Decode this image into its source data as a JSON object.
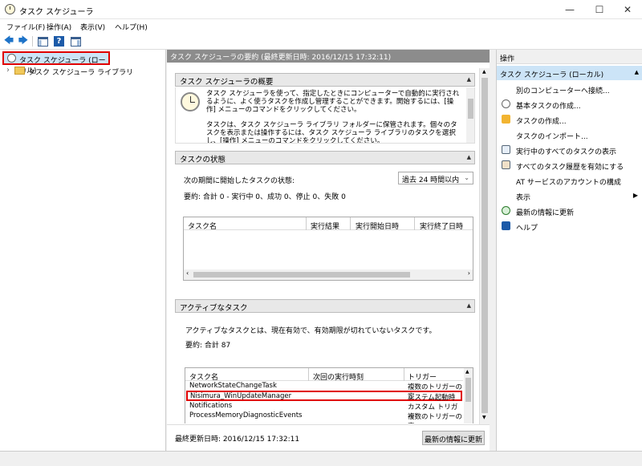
{
  "window": {
    "title": "タスク スケジューラ",
    "min": "—",
    "max": "☐",
    "close": "✕"
  },
  "menu": [
    "ファイル(F)",
    "操作(A)",
    "表示(V)",
    "ヘルプ(H)"
  ],
  "toolbar": {
    "back": "🡄",
    "forward": "🡆",
    "help": "?"
  },
  "tree": {
    "root": "タスク スケジューラ (ローカル)",
    "library": "タスク スケジューラ ライブラリ",
    "expand": "›"
  },
  "center": {
    "header": "タスク スケジューラの要約 (最終更新日時: 2016/12/15 17:32:11)",
    "overview": {
      "title": "タスク スケジューラの概要",
      "p1": "タスク スケジューラを使って、指定したときにコンピューターで自動的に実行されるように、よく使うタスクを作成し管理することができます。開始するには、[操作] メニューのコマンドをクリックしてください。",
      "p2": "タスクは、タスク スケジューラ ライブラリ フォルダーに保管されます。個々のタスクを表示または操作するには、タスク スケジューラ ライブラリのタスクを選択し、[操作] メニューのコマンドをクリックしてください。"
    },
    "status": {
      "title": "タスクの状態",
      "label": "次の期間に開始したタスクの状態:",
      "period": "過去 24 時間以内",
      "summary": "要約: 合計 0 - 実行中 0、成功 0、停止 0、失敗 0",
      "columns": [
        "タスク名",
        "実行結果",
        "実行開始日時",
        "実行終了日時"
      ]
    },
    "active": {
      "title": "アクティブなタスク",
      "desc": "アクティブなタスクとは、現在有効で、有効期限が切れていないタスクです。",
      "summary": "要約: 合計 87",
      "columns": [
        "タスク名",
        "次回の実行時刻",
        "トリガー"
      ],
      "rows": [
        {
          "name": "NetworkStateChangeTask",
          "next": "",
          "trigger": "複数のトリガーの定"
        },
        {
          "name": "Nisimura_WinUpdateManager",
          "next": "",
          "trigger": "システム起動時"
        },
        {
          "name": "Notifications",
          "next": "",
          "trigger": "カスタム トリガー"
        },
        {
          "name": "ProcessMemoryDiagnosticEvents",
          "next": "",
          "trigger": "複数のトリガーの定"
        }
      ]
    },
    "footer": {
      "last_updated": "最終更新日時: 2016/12/15 17:32:11",
      "refresh": "最新の情報に更新"
    }
  },
  "actions": {
    "title": "操作",
    "subtitle": "タスク スケジューラ (ローカル)",
    "items": [
      {
        "label": "別のコンピューターへ接続...",
        "icon": "none"
      },
      {
        "label": "基本タスクの作成...",
        "icon": "clock-icon"
      },
      {
        "label": "タスクの作成...",
        "icon": "new-task-icon"
      },
      {
        "label": "タスクのインポート...",
        "icon": "none"
      },
      {
        "label": "実行中のすべてのタスクの表示",
        "icon": "list-icon"
      },
      {
        "label": "すべてのタスク履歴を有効にする",
        "icon": "history-icon"
      },
      {
        "label": "AT サービスのアカウントの構成",
        "icon": "none"
      },
      {
        "label": "表示",
        "icon": "none",
        "submenu": "▶"
      },
      {
        "label": "最新の情報に更新",
        "icon": "refresh-icon"
      },
      {
        "label": "ヘルプ",
        "icon": "help-icon"
      }
    ]
  },
  "colors": {
    "highlight": "#e00000",
    "selection": "#cce4f7",
    "section_header": "#8c8c8c"
  }
}
